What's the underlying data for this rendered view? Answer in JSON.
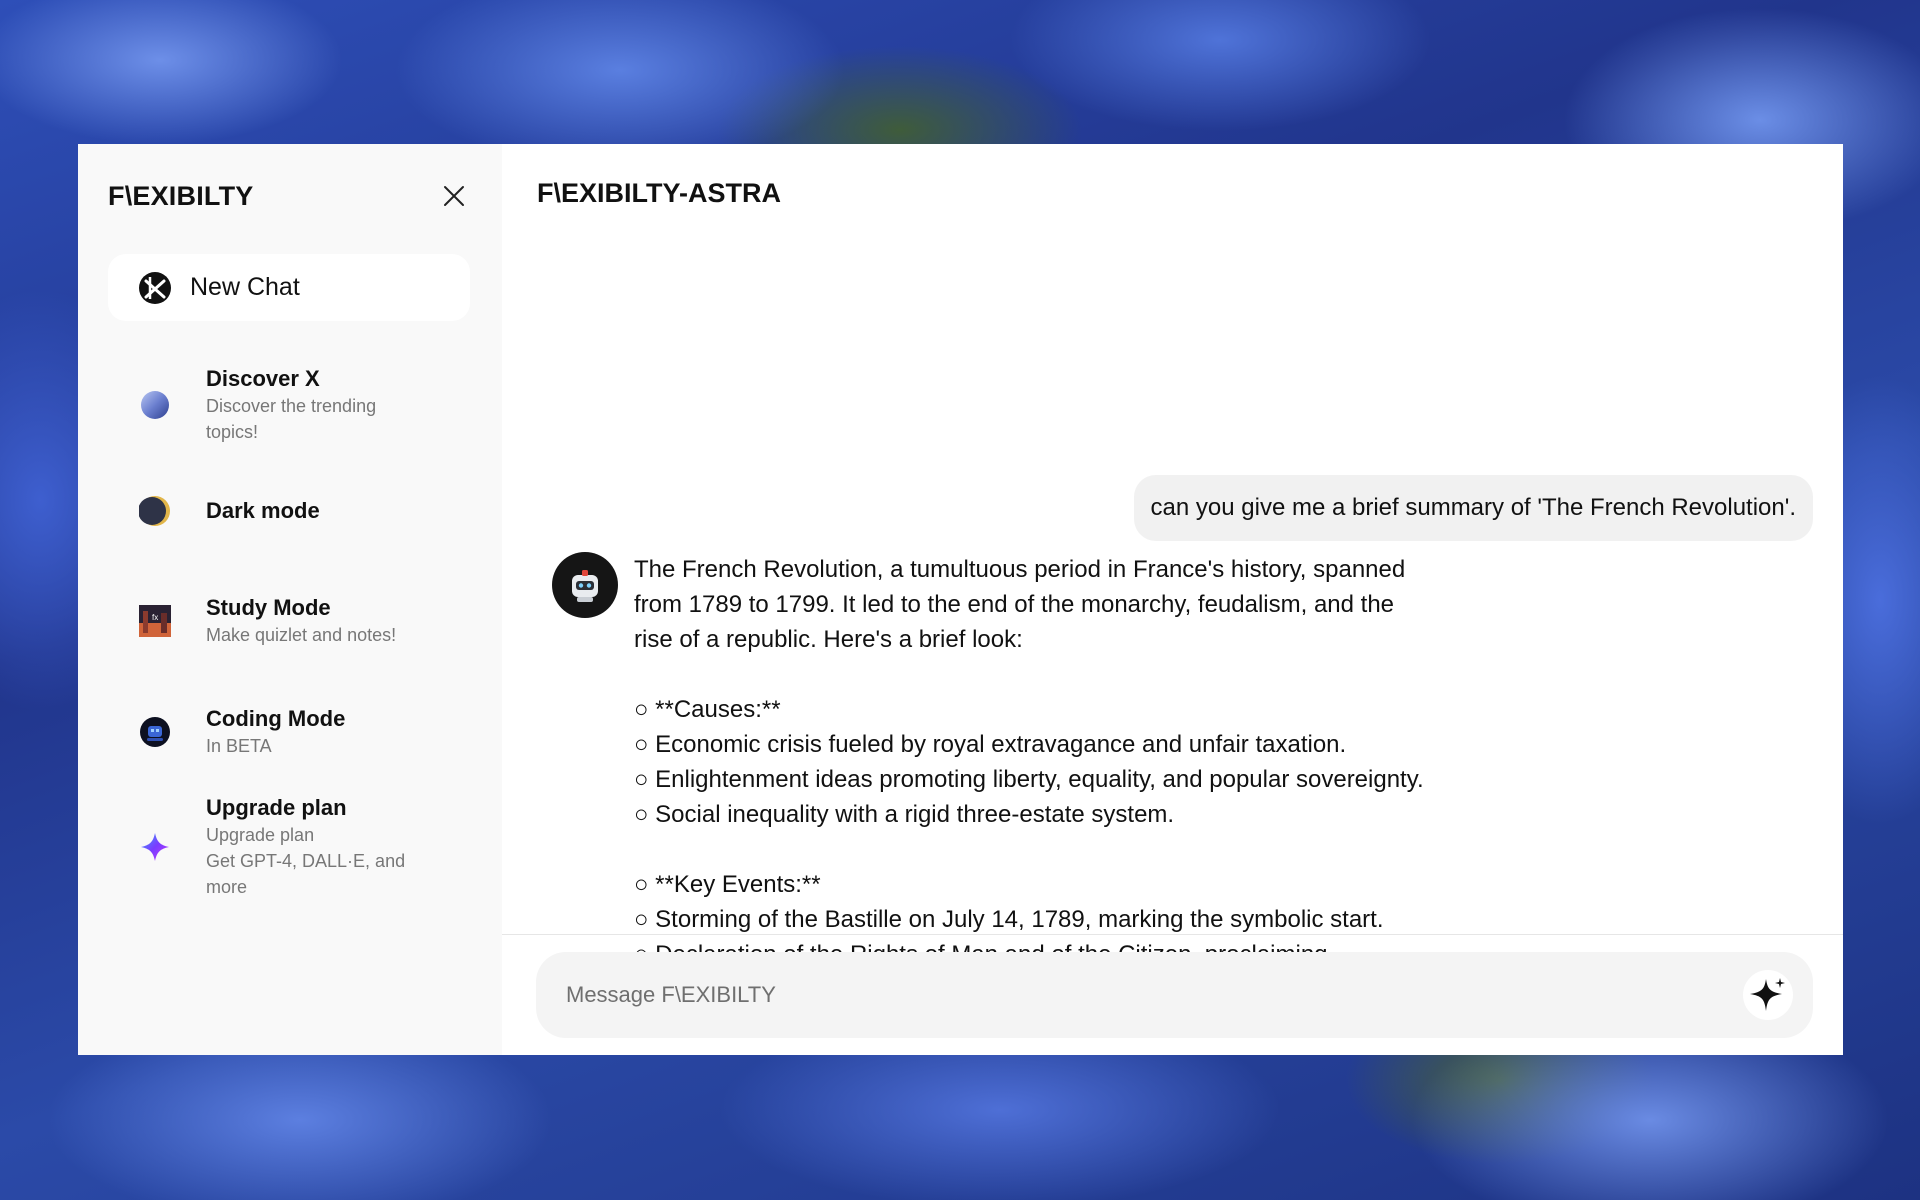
{
  "sidebar": {
    "brand": "F\\EXIBILTY",
    "new_chat_label": "New Chat",
    "items": [
      {
        "title": "Discover X",
        "subtitle": "Discover the trending topics!",
        "icon": "blue-orb-icon"
      },
      {
        "title": "Dark mode",
        "subtitle": "",
        "icon": "moon-icon"
      },
      {
        "title": "Study Mode",
        "subtitle": "Make quizlet and notes!",
        "icon": "study-image-icon"
      },
      {
        "title": "Coding Mode",
        "subtitle": "In BETA",
        "icon": "robot-icon"
      },
      {
        "title": "Upgrade plan",
        "subtitle": "Upgrade plan\nGet GPT-4, DALL·E, and more",
        "icon": "sparkle-gem-icon"
      }
    ]
  },
  "main": {
    "title": "F\\EXIBILTY-ASTRA",
    "user_message": "can you give me a brief summary of 'The French Revolution'.",
    "assistant_reply": "The French Revolution, a tumultuous period in France's history, spanned from 1789 to 1799. It led to the end of the monarchy, feudalism, and the rise of a republic. Here's a brief look:\n\n○ **Causes:**\n○ Economic crisis fueled by royal extravagance and unfair taxation.\n○ Enlightenment ideas promoting liberty, equality, and popular sovereignty.\n○ Social inequality with a rigid three-estate system.\n\n○ **Key Events:**\n○ Storming of the Bastille on July 14, 1789, marking the symbolic start.\n○ Declaration of the Rights of Man and of the Citizen, proclaiming",
    "composer_placeholder": "Message F\\EXIBILTY"
  }
}
